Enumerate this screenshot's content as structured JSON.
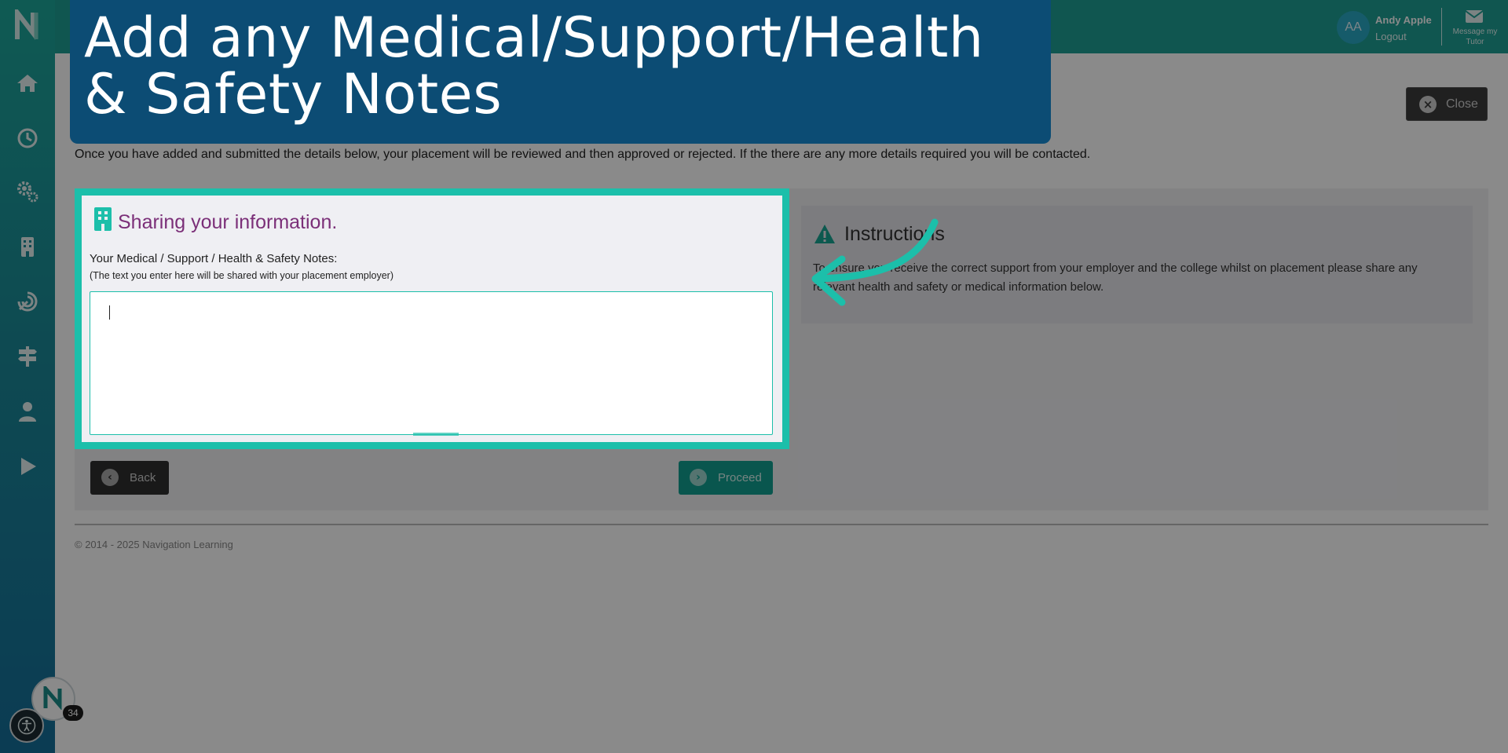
{
  "banner": {
    "headline": "Add any Medical/Support/Health & Safety Notes"
  },
  "topbar": {
    "avatar_initials": "AA",
    "user_name": "Andy Apple",
    "logout_label": "Logout",
    "message_label": "Message my Tutor"
  },
  "sidebar": {
    "items": [
      {
        "icon": "home-icon"
      },
      {
        "icon": "clock-icon"
      },
      {
        "icon": "gears-icon"
      },
      {
        "icon": "building-icon"
      },
      {
        "icon": "target-icon"
      },
      {
        "icon": "signpost-icon"
      },
      {
        "icon": "user-icon"
      },
      {
        "icon": "play-icon"
      }
    ],
    "notification_count": "34"
  },
  "header": {
    "close_label": "Close"
  },
  "intro_text": "Once you have added and submitted the details below, your placement will be reviewed and then approved or rejected. If the there are any more details required you will be contacted.",
  "card": {
    "title": "Sharing your information.",
    "field_label": "Your Medical / Support / Health & Safety Notes:",
    "field_hint": "(The text you enter here will be shared with your placement employer)",
    "notes_value": ""
  },
  "instructions": {
    "title": "Instructions",
    "text": "To ensure you receive the correct support from your employer and the college whilst on placement please share any relevant health and safety or medical information below."
  },
  "buttons": {
    "back_label": "Back",
    "proceed_label": "Proceed"
  },
  "footer": {
    "copyright": "© 2014 - 2025 Navigation Learning"
  },
  "colors": {
    "accent": "#1cbfaa",
    "banner": "#0c4c74",
    "title_purple": "#7b2f78",
    "topbar": "#1f9f95"
  }
}
